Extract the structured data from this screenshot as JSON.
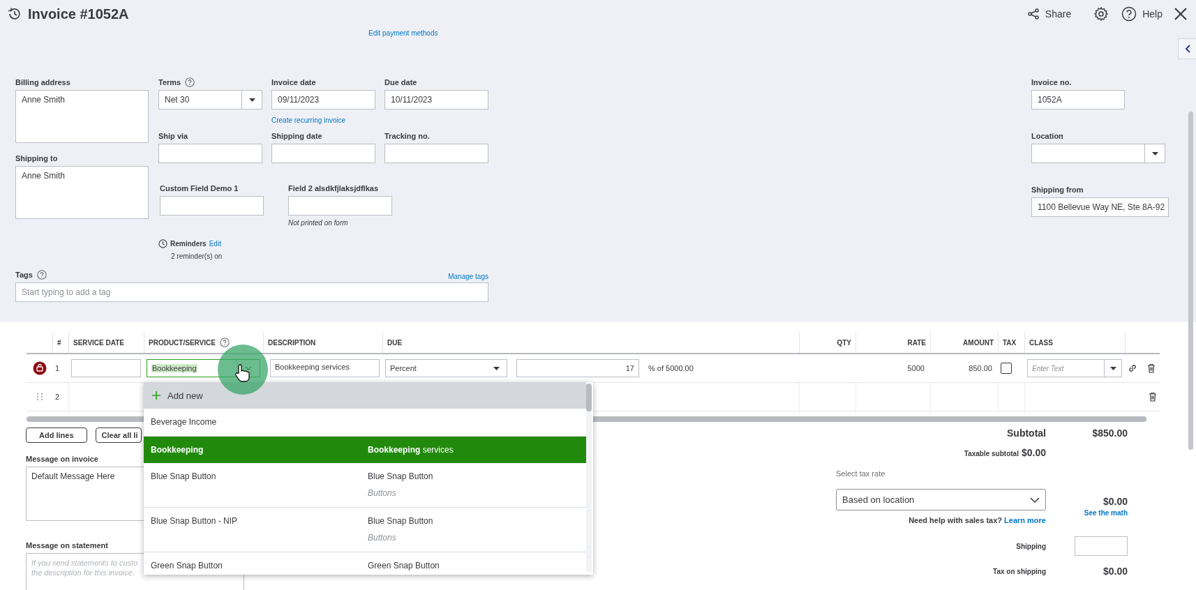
{
  "header": {
    "title": "Invoice #1052A",
    "share": "Share",
    "help": "Help"
  },
  "payment_link": "Edit payment methods",
  "billing_address": {
    "label": "Billing address",
    "value": "Anne Smith"
  },
  "shipping_to": {
    "label": "Shipping to",
    "value": "Anne Smith"
  },
  "terms": {
    "label": "Terms",
    "value": "Net 30"
  },
  "invoice_date": {
    "label": "Invoice date",
    "value": "09/11/2023"
  },
  "recurring_link": "Create recurring invoice",
  "due_date": {
    "label": "Due date",
    "value": "10/11/2023"
  },
  "ship_via": {
    "label": "Ship via"
  },
  "shipping_date": {
    "label": "Shipping date"
  },
  "tracking_no": {
    "label": "Tracking no."
  },
  "custom_fields": [
    {
      "label": "Custom Field Demo 1"
    },
    {
      "label": "Field 2 alsdkfjlaksjdflkas",
      "note": "Not printed on form"
    }
  ],
  "reminders": {
    "label": "Reminders",
    "link": "Edit",
    "status": "2 reminder(s) on"
  },
  "tags": {
    "label": "Tags",
    "link": "Manage tags",
    "placeholder": "Start typing to add a tag"
  },
  "invoice_no": {
    "label": "Invoice no.",
    "value": "1052A"
  },
  "location": {
    "label": "Location"
  },
  "shipping_from": {
    "label": "Shipping from",
    "value": "1100 Bellevue Way NE, Ste 8A-92"
  },
  "table": {
    "columns": [
      {
        "label": "#",
        "kind": "plain"
      },
      {
        "label": "SERVICE DATE",
        "kind": "plain"
      },
      {
        "label": "PRODUCT/SERVICE",
        "kind": "help"
      },
      {
        "label": "DESCRIPTION",
        "kind": "plain"
      },
      {
        "label": "DUE",
        "kind": "plain"
      },
      {
        "label": "QTY",
        "kind": "plain"
      },
      {
        "label": "RATE",
        "kind": "plain"
      },
      {
        "label": "AMOUNT",
        "kind": "plain"
      },
      {
        "label": "TAX",
        "kind": "plain"
      },
      {
        "label": "CLASS",
        "kind": "plain"
      }
    ],
    "rows": [
      {
        "kind": "item",
        "number": "1",
        "product": "Bookkeeping",
        "description": "Bookkeeping services",
        "due_type": "Percent",
        "due_value": "17",
        "due_note": "% of 5000.00",
        "rate": "5000",
        "amount": "850.00",
        "tax": false,
        "class_placeholder": "Enter Text"
      },
      {
        "kind": "empty",
        "number": "2"
      }
    ]
  },
  "dropdown": {
    "add_new": "Add new",
    "items": [
      {
        "name": "Beverage Income",
        "selected": false
      },
      {
        "name": "Bookkeeping",
        "description": "**Bookkeeping** services",
        "selected": true
      },
      {
        "name": "Blue Snap Button",
        "description": "Blue Snap Button",
        "category": "Buttons",
        "selected": false
      },
      {
        "name": "Blue Snap Button - NIP",
        "description": "Blue Snap Button",
        "category": "Buttons",
        "selected": false
      },
      {
        "name": "Green Snap Button",
        "description": "Green Snap Button",
        "selected": false
      }
    ]
  },
  "add_lines": "Add lines",
  "clear_lines": "Clear all li",
  "message_invoice": {
    "label": "Message on invoice",
    "value": "Default Message Here"
  },
  "message_statement": {
    "label": "Message on statement",
    "placeholder": "If you send statements to custo\nthe description for this invoice."
  },
  "totals": {
    "subtotal": {
      "label": "Subtotal",
      "value": "$850.00"
    },
    "taxable_subtotal": {
      "label": "Taxable subtotal",
      "value": "$0.00"
    },
    "tax_rate": {
      "label": "Select tax rate",
      "value": "Based on location",
      "amount": "$0.00",
      "link": "See the math"
    },
    "help_text": "Need help with sales tax?",
    "help_link": "Learn more",
    "shipping": {
      "label": "Shipping"
    },
    "tax_on_shipping": {
      "label": "Tax on shipping",
      "value": "$0.00"
    }
  }
}
